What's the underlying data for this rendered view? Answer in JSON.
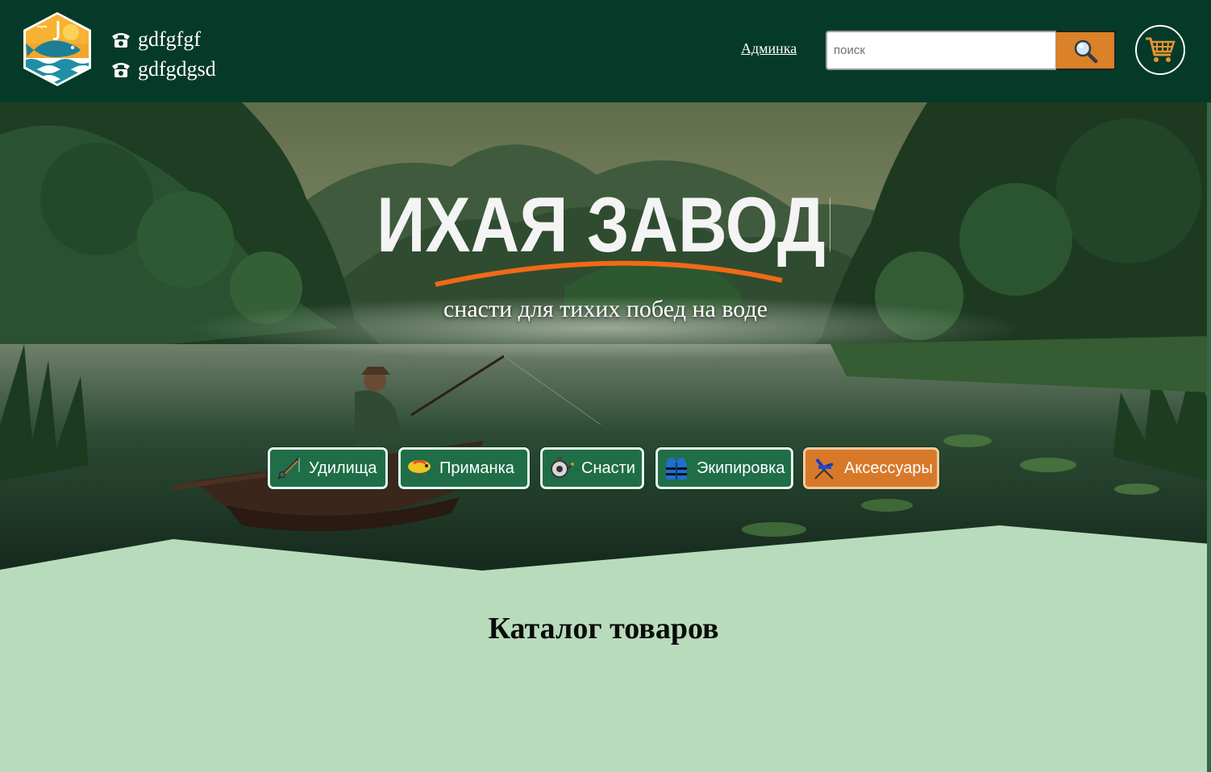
{
  "header": {
    "phones": [
      "gdfgfgf",
      "gdfgdgsd"
    ],
    "admin_link": "Админка",
    "search": {
      "placeholder": "поиск",
      "value": ""
    }
  },
  "hero": {
    "brand": "ТИХАЯ ЗАВОДЬ",
    "tagline": "снасти для тихих побед на воде"
  },
  "categories": [
    {
      "label": "Удилища",
      "icon": "fishing-rod-icon"
    },
    {
      "label": "Приманка",
      "icon": "lure-icon"
    },
    {
      "label": "Снасти",
      "icon": "reel-icon"
    },
    {
      "label": "Экипировка",
      "icon": "life-vest-icon"
    },
    {
      "label": "Аксессуары",
      "icon": "folding-chair-icon",
      "active": true
    }
  ],
  "catalog": {
    "title": "Каталог товаров"
  },
  "colors": {
    "header_bg": "#053a29",
    "accent_orange": "#db8127",
    "category_green": "#1f6e47",
    "page_bg": "#b8dcbb"
  }
}
